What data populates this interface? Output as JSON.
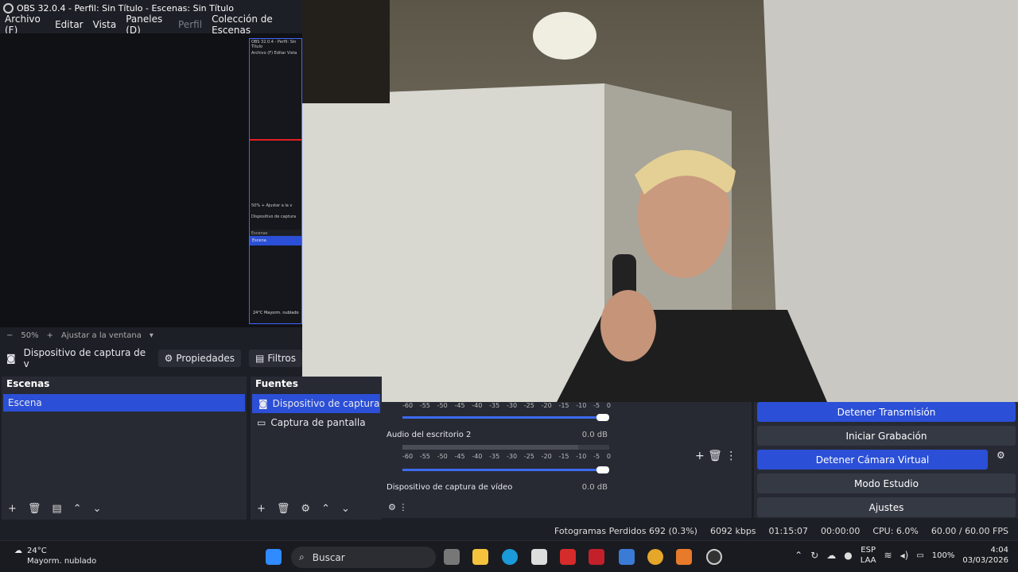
{
  "window": {
    "title": "OBS 32.0.4 - Perfil: Sin Título - Escenas: Sin Título"
  },
  "menu": [
    "Archivo (F)",
    "Editar",
    "Vista",
    "Paneles (D)",
    "Perfil",
    "Colección de Escenas"
  ],
  "mini_preview": {
    "title": "OBS 32.0.4 - Perfil: Sin Título",
    "menu": "Archivo (F)  Editar  Vista",
    "zoom": "50%  +  Ajustar a la v",
    "source": "Dispositivo de captura",
    "scenes_label": "Escenas",
    "scene": "Escena",
    "weather": "24°C Mayorm. nublado"
  },
  "zoom": {
    "minus": "−",
    "level": "50%",
    "plus": "+",
    "fit": "Ajustar a la ventana"
  },
  "source_toolbar": {
    "name": "Dispositivo de captura de v",
    "props": "Propiedades",
    "filters": "Filtros"
  },
  "scenes": {
    "title": "Escenas",
    "items": [
      "Escena"
    ]
  },
  "sources": {
    "title": "Fuentes",
    "items": [
      "Dispositivo de captura de v",
      "Captura de pantalla"
    ]
  },
  "mixer": {
    "scale": [
      "-60",
      "-55",
      "-50",
      "-45",
      "-40",
      "-35",
      "-30",
      "-25",
      "-20",
      "-15",
      "-10",
      "-5",
      "0"
    ],
    "channels": [
      {
        "name": "Audio del escritorio 2",
        "db": "0.0 dB"
      },
      {
        "name": "Dispositivo de captura de vídeo",
        "db": "0.0 dB"
      }
    ]
  },
  "controls": {
    "stream": "Detener Transmisión",
    "record": "Iniciar Grabación",
    "vcam": "Detener Cámara Virtual",
    "studio": "Modo Estudio",
    "settings": "Ajustes"
  },
  "status": {
    "dropped": "Fotogramas Perdidos 692 (0.3%)",
    "bitrate": "6092 kbps",
    "stream_time": "01:15:07",
    "rec_time": "00:00:00",
    "cpu": "CPU: 6.0%",
    "fps": "60.00 / 60.00 FPS"
  },
  "taskbar": {
    "temp": "24°C",
    "weather": "Mayorm. nublado",
    "search": "Buscar",
    "lang": "ESP",
    "lang2": "LAA",
    "battery": "100%",
    "time": "4:04",
    "date": "03/03/2026"
  }
}
